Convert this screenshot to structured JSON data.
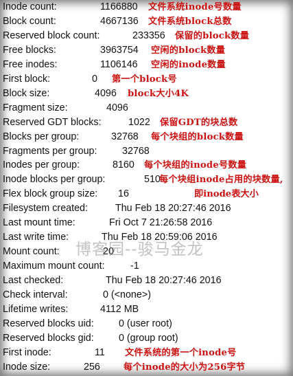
{
  "rows": [
    {
      "label": "Inode count:",
      "value": "1166880",
      "note": "文件系统inode号数量"
    },
    {
      "label": "Block count:",
      "value": "4667136",
      "note": "文件系统block总数"
    },
    {
      "label": "Reserved block count:",
      "value": "233356",
      "note": "保留的block数量"
    },
    {
      "label": "Free blocks:",
      "value": "3963754",
      "note": "空闲的block数量"
    },
    {
      "label": "Free inodes:",
      "value": "1106146",
      "note": "空闲的inode数量"
    },
    {
      "label": "First block:",
      "value": "0",
      "note": "第一个block号"
    },
    {
      "label": "Block size:",
      "value": "4096",
      "note": "block大小4K"
    },
    {
      "label": "Fragment size:",
      "value": "4096",
      "note": ""
    },
    {
      "label": "Reserved GDT blocks:",
      "value": "1022",
      "note": "保留GDT的块总数"
    },
    {
      "label": "Blocks per group:",
      "value": "32768",
      "note": "每个块组的block数量"
    },
    {
      "label": "Fragments per group:",
      "value": "32768",
      "note": ""
    },
    {
      "label": "Inodes per group:",
      "value": "8160",
      "note": "每个块组的inode号数量"
    },
    {
      "label": "Inode blocks per group:",
      "value": "510",
      "note": "每个块组inode占用的块数量,",
      "note2": "即inode表大小"
    },
    {
      "label": "Flex block group size:",
      "value": "16",
      "note": ""
    },
    {
      "label": "Filesystem created:",
      "value": "Thu Feb 18 20:27:46 2016",
      "note": ""
    },
    {
      "label": "Last mount time:",
      "value": "Fri Oct  7 21:26:58 2016",
      "note": ""
    },
    {
      "label": "Last write time:",
      "value": "Thu Feb 18 20:59:06 2016",
      "note": ""
    },
    {
      "label": "Mount count:",
      "value": "20",
      "note": ""
    },
    {
      "label": "Maximum mount count:",
      "value": "-1",
      "note": ""
    },
    {
      "label": "Last checked:",
      "value": "Thu Feb 18 20:27:46 2016",
      "note": ""
    },
    {
      "label": "Check interval:",
      "value": "0 (<none>)",
      "note": ""
    },
    {
      "label": "Lifetime writes:",
      "value": "4112 MB",
      "note": ""
    },
    {
      "label": "Reserved blocks uid:",
      "value": "0 (user root)",
      "note": ""
    },
    {
      "label": "Reserved blocks gid:",
      "value": "0 (group root)",
      "note": ""
    },
    {
      "label": "First inode:",
      "value": "11",
      "note": "文件系统的第一个inode号"
    },
    {
      "label": "Inode size:",
      "value": "256",
      "note": "每个inode的大小为256字节"
    }
  ],
  "watermark": "博客园--骏马金龙"
}
